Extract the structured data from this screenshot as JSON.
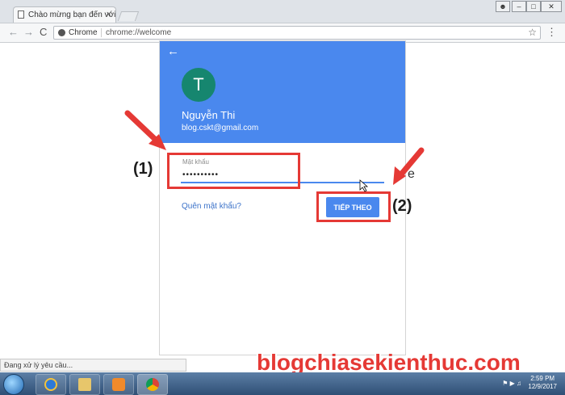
{
  "browser": {
    "tab_title": "Chào mừng bạn đến với",
    "tab_close": "×",
    "omnibox_site": "Chrome",
    "omnibox_url": "chrome://welcome",
    "back": "←",
    "forward": "→",
    "reload": "C",
    "star": "☆",
    "menu": "⋮"
  },
  "login": {
    "avatar_letter": "T",
    "user_name": "Nguyễn Thi",
    "user_email": "blog.cskt@gmail.com",
    "password_label": "Mật khẩu",
    "password_value": "••••••••••",
    "forgot_link": "Quên mật khẩu?",
    "next_button": "TIẾP THEO"
  },
  "annotations": {
    "step1": "(1)",
    "step2": "(2)",
    "accent_color": "#e53935"
  },
  "status": {
    "text": "Đang xử lý yêu cầu..."
  },
  "watermark": "blogchiasekienthuc.com",
  "taskbar": {
    "time": "2:59 PM",
    "date": "12/9/2017"
  },
  "colors": {
    "header_blue": "#4a88ee",
    "avatar_green": "#16866f"
  }
}
